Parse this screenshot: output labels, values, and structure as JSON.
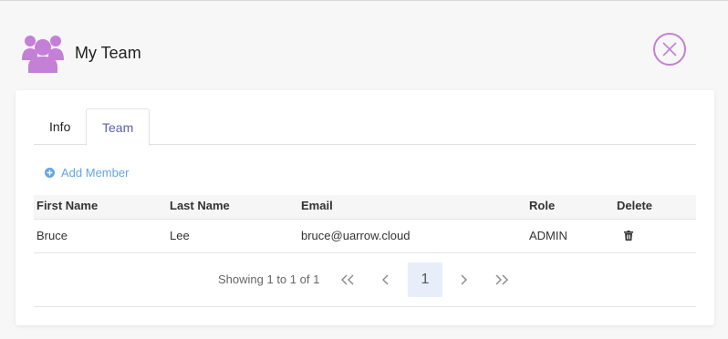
{
  "modal": {
    "title": "My Team",
    "icon": "team-users-icon",
    "close_icon": "close-circle-icon",
    "accent_color": "#c47fd6"
  },
  "tabs": [
    {
      "label": "Info",
      "active": false
    },
    {
      "label": "Team",
      "active": true
    }
  ],
  "actions": {
    "add_member_label": "Add Member",
    "add_member_icon": "plus-circle-icon"
  },
  "table": {
    "columns": [
      "First Name",
      "Last Name",
      "Email",
      "Role",
      "Delete"
    ],
    "rows": [
      {
        "first_name": "Bruce",
        "last_name": "Lee",
        "email": "bruce@uarrow.cloud",
        "role": "ADMIN",
        "delete_icon": "trash-icon"
      }
    ]
  },
  "pagination": {
    "summary": "Showing 1 to 1 of 1",
    "current_page": "1",
    "first_icon": "double-chevron-left-icon",
    "prev_icon": "chevron-left-icon",
    "next_icon": "chevron-right-icon",
    "last_icon": "double-chevron-right-icon"
  }
}
